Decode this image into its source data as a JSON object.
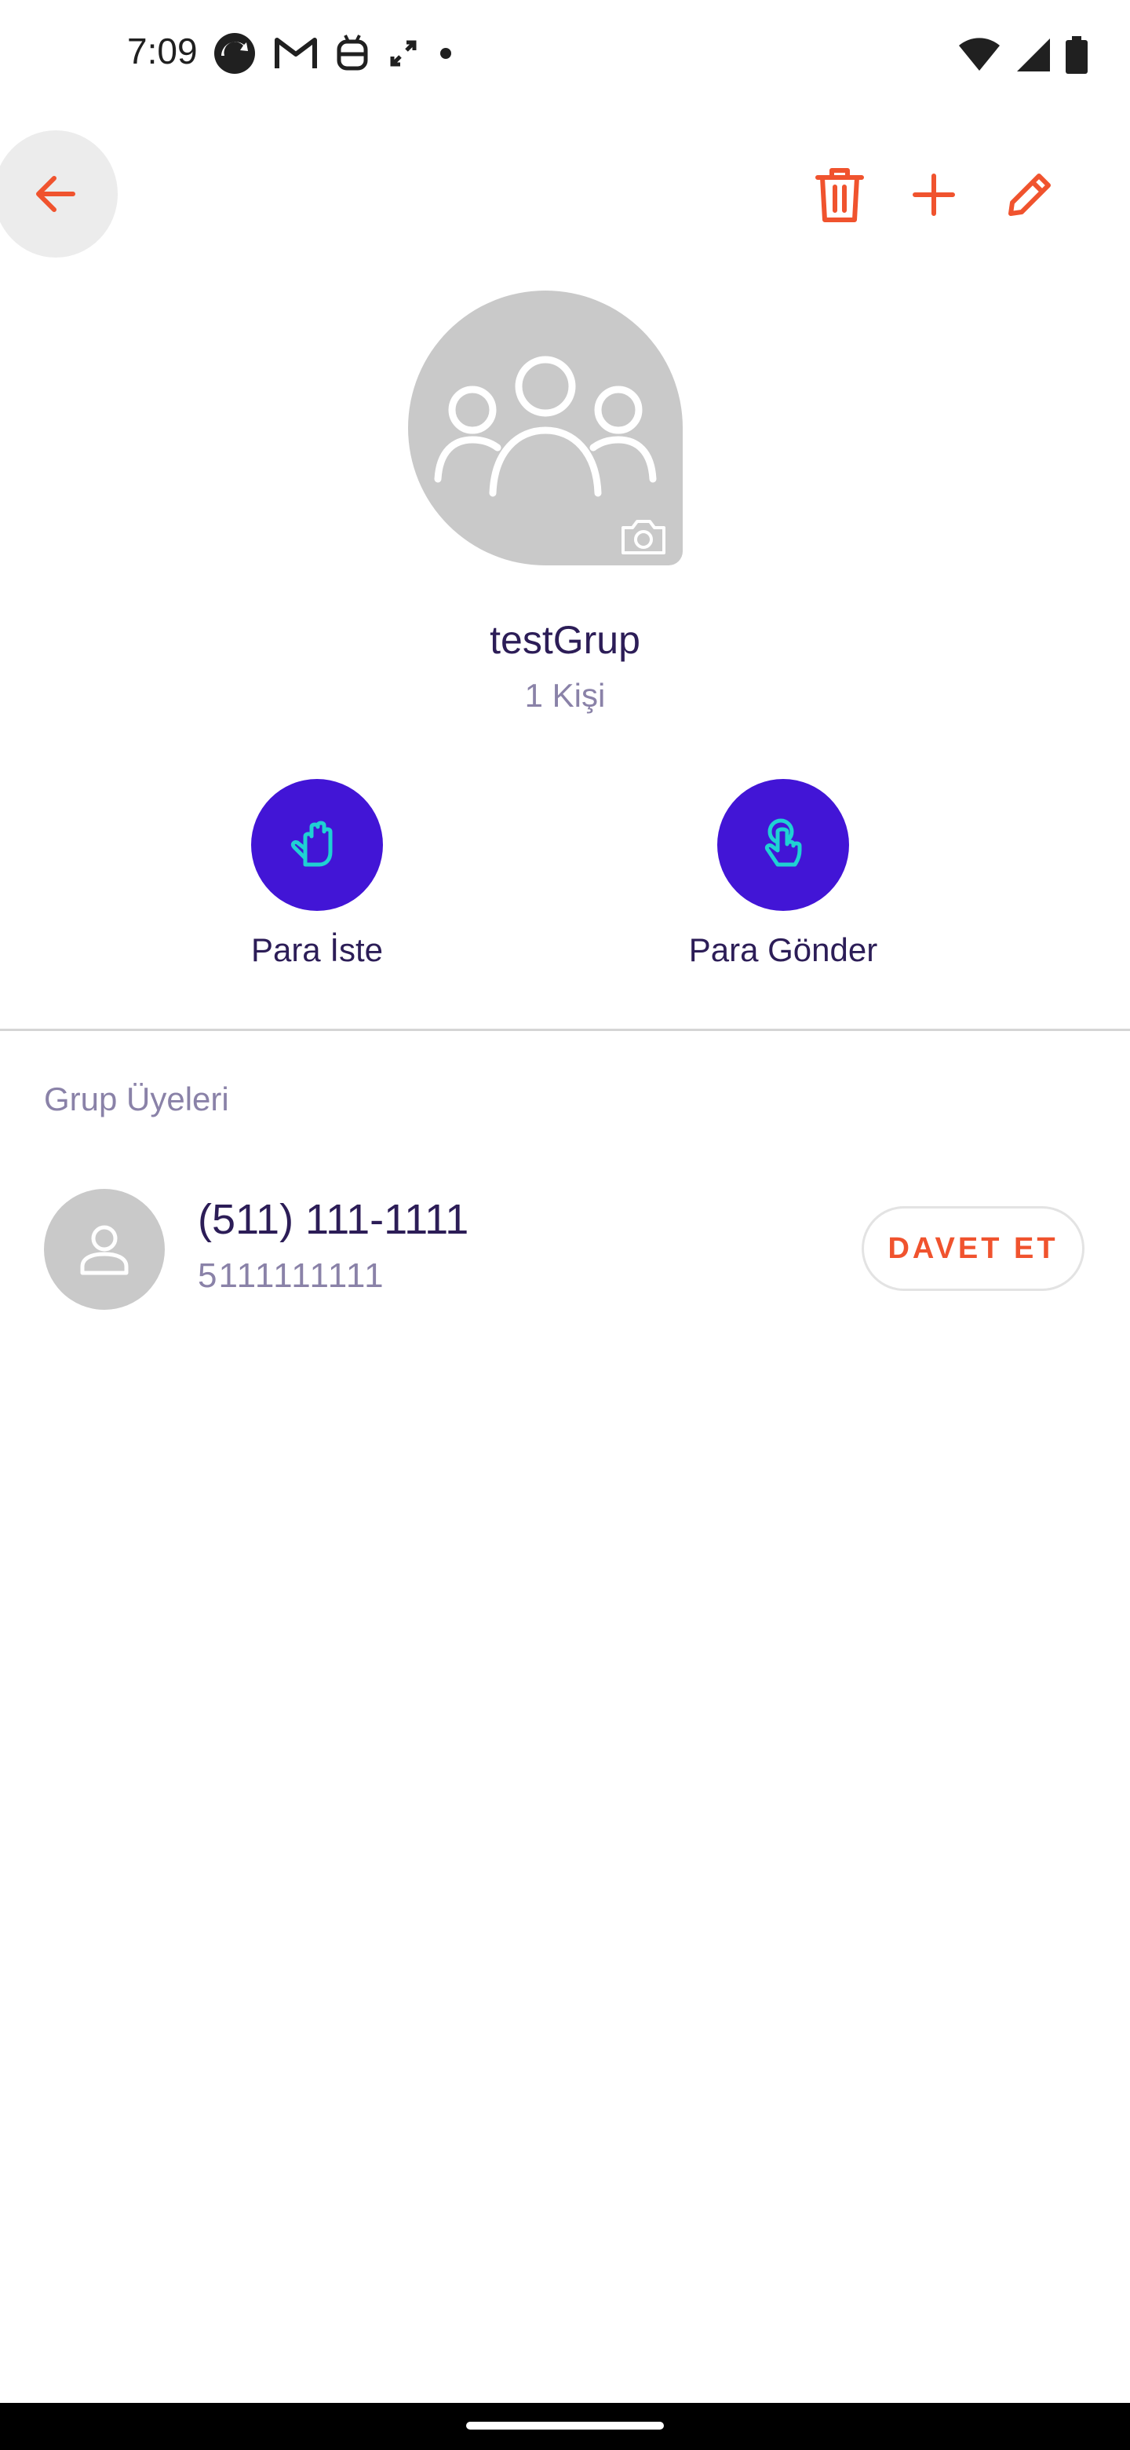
{
  "status_bar": {
    "time": "7:09",
    "left_icons": [
      "sync-icon",
      "gmail-icon",
      "android-icon",
      "unfold-icon",
      "dot-icon"
    ],
    "right_icons": [
      "wifi-icon",
      "signal-icon",
      "battery-icon"
    ]
  },
  "toolbar": {
    "back_icon": "arrow-left-icon",
    "delete_icon": "trash-icon",
    "add_icon": "plus-icon",
    "edit_icon": "pencil-icon",
    "accent": "#f0532e"
  },
  "group": {
    "name": "testGrup",
    "member_count": "1 Kişi",
    "avatar_icon": "group-icon",
    "camera_icon": "camera-icon"
  },
  "actions": [
    {
      "label": "Para İste",
      "icon": "hand-icon"
    },
    {
      "label": "Para Gönder",
      "icon": "tap-icon"
    }
  ],
  "members_section": {
    "title": "Grup Üyeleri",
    "members": [
      {
        "name": "(511) 111-1111",
        "number": "5111111111",
        "invite_label": "DAVET ET"
      }
    ]
  },
  "colors": {
    "primary": "#4215d6",
    "accent": "#f0532e",
    "icon_cyan": "#1fd1d3",
    "text_primary": "#2c1d57",
    "text_secondary": "#8a82a8"
  }
}
